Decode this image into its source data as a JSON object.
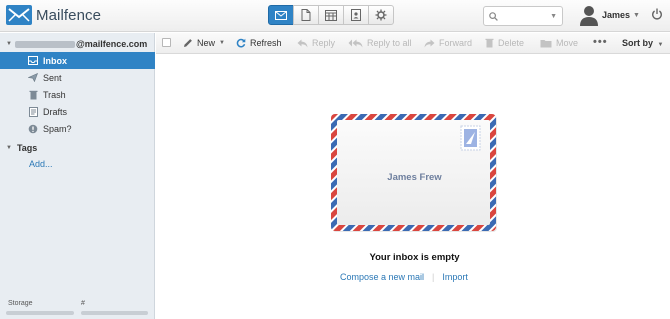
{
  "header": {
    "app_name": "Mailfence",
    "apps": [
      {
        "name": "mail",
        "icon": "envelope-icon",
        "active": true
      },
      {
        "name": "documents",
        "icon": "document-icon",
        "active": false
      },
      {
        "name": "calendar",
        "icon": "calendar-icon",
        "active": false
      },
      {
        "name": "contacts",
        "icon": "contacts-icon",
        "active": false
      },
      {
        "name": "settings",
        "icon": "gear-icon",
        "active": false
      }
    ],
    "search": {
      "placeholder": "",
      "value": ""
    },
    "user_name": "James",
    "accent_color": "#2f83c5"
  },
  "sidebar": {
    "account_suffix": "@mailfence.com",
    "folders": [
      {
        "label": "Inbox",
        "icon": "inbox-icon",
        "selected": true
      },
      {
        "label": "Sent",
        "icon": "sent-icon",
        "selected": false
      },
      {
        "label": "Trash",
        "icon": "trash-icon",
        "selected": false
      },
      {
        "label": "Drafts",
        "icon": "drafts-icon",
        "selected": false
      },
      {
        "label": "Spam?",
        "icon": "spam-icon",
        "selected": false
      }
    ],
    "tags_label": "Tags",
    "add_label": "Add...",
    "storage_label": "Storage",
    "count_label": "#"
  },
  "toolbar": {
    "new_label": "New",
    "refresh_label": "Refresh",
    "reply_label": "Reply",
    "reply_all_label": "Reply to all",
    "forward_label": "Forward",
    "delete_label": "Delete",
    "move_label": "Move",
    "more_label": "•••",
    "sort_label": "Sort by"
  },
  "main": {
    "envelope_name": "James Frew",
    "empty_title": "Your inbox is empty",
    "compose_link": "Compose a new mail",
    "link_separator": "|",
    "import_link": "Import"
  }
}
